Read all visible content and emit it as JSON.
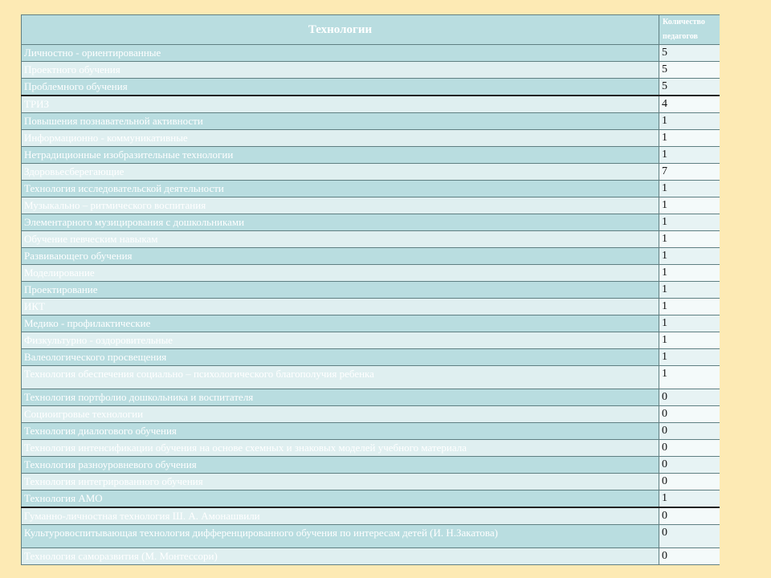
{
  "table": {
    "header": {
      "technology": "Технологии",
      "count": "Количество педагогов"
    },
    "rows": [
      {
        "name": "Личностно - ориентированные",
        "count": "5"
      },
      {
        "name": "Проектного обучения",
        "count": "5"
      },
      {
        "name": "Проблемного обучения",
        "count": "5"
      },
      {
        "name": "ТРИЗ",
        "count": "4"
      },
      {
        "name": "Повышения познавательной активности",
        "count": "1"
      },
      {
        "name": "Информационно - коммуникативные",
        "count": "1"
      },
      {
        "name": "Нетрадиционные изобразительные технологии",
        "count": "1"
      },
      {
        "name": "Здоровьесберегающие",
        "count": "7"
      },
      {
        "name": "Технология исследовательской деятельности",
        "count": "1"
      },
      {
        "name": "Музыкально – ритмического воспитания",
        "count": "1"
      },
      {
        "name": "Элементарного музицирования с дошкольниками",
        "count": "1"
      },
      {
        "name": "Обучение певческим навыкам",
        "count": "1"
      },
      {
        "name": "Развивающего обучения",
        "count": "1"
      },
      {
        "name": "Моделирование",
        "count": "1"
      },
      {
        "name": "Проектирование",
        "count": "1"
      },
      {
        "name": "ИКТ",
        "count": "1"
      },
      {
        "name": "Медико - профилактические",
        "count": "1"
      },
      {
        "name": "Физкультурно - оздоровительные",
        "count": "1"
      },
      {
        "name": "Валеологического просвещения",
        "count": "1"
      },
      {
        "name": "Технология обеспечения социально – психологического благополучия ребенка",
        "count": "1"
      },
      {
        "name": "Технология портфолио дошкольника и воспитателя",
        "count": "0"
      },
      {
        "name": "Социоигровые технологии",
        "count": "0"
      },
      {
        "name": "Технология диалогового обучения",
        "count": "0"
      },
      {
        "name": "Технология интенсификации обучения на основе схемных и знаковых моделей учебного материала",
        "count": "0"
      },
      {
        "name": "Технология разноуровневого обучения",
        "count": "0"
      },
      {
        "name": "Технология интегрированного обучения",
        "count": "0"
      },
      {
        "name": "Технология АМО",
        "count": "1"
      },
      {
        "name": "Гуманно-личностная технология Ш. А. Амонашвили",
        "count": "0"
      },
      {
        "name": "Культуровоспитывающая технология дифференцированного обучения по интересам детей (И. Н.Закатова)",
        "count": "0"
      },
      {
        "name": "Технология саморазвития (М. Монтессори)",
        "count": "0"
      }
    ]
  }
}
